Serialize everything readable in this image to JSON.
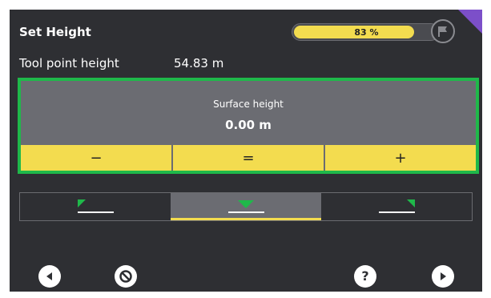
{
  "header": {
    "title": "Set Height"
  },
  "progress": {
    "text": "83 %",
    "fraction": 0.83
  },
  "tool_point": {
    "label": "Tool point height",
    "value": "54.83 m"
  },
  "surface": {
    "label": "Surface height",
    "value": "0.00 m"
  },
  "buttons": {
    "minus": "−",
    "equals": "=",
    "plus": "+"
  },
  "alignment_options": [
    "left-edge",
    "center",
    "right-edge"
  ],
  "selected_alignment": "center",
  "bottom_icons": [
    "back-icon",
    "cancel-icon",
    "help-icon",
    "next-icon"
  ],
  "colors": {
    "accent": "#f3dc4f",
    "highlight": "#1fb84a",
    "background": "#2e2f33",
    "panel": "#6b6c72",
    "corner": "#7c4fc9"
  }
}
